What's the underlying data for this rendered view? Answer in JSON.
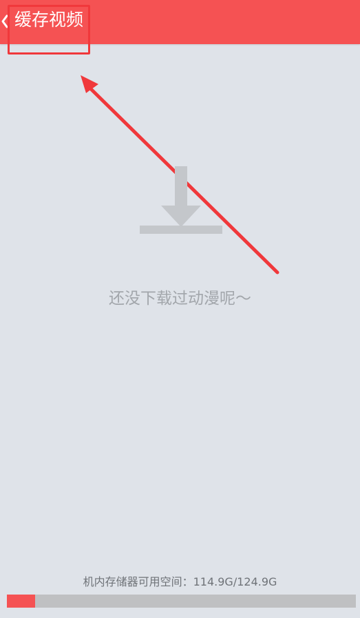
{
  "colors": {
    "header": "#f55253",
    "background": "#dfe3e9",
    "annotation": "#f0383b",
    "icon": "#c4c7cb",
    "muted_text": "#a2a6ab",
    "storage_bar": "#bfc0c2"
  },
  "header": {
    "back_icon": "chevron-left-icon",
    "title": "缓存视频"
  },
  "empty_state": {
    "icon": "download-icon",
    "message": "还没下载过动漫呢～"
  },
  "storage": {
    "label": "机内存储器可用空间：",
    "value": "114.9G/124.9G",
    "used_fraction": 0.08
  },
  "annotation": {
    "shape": "arrow-pointing-to-title"
  }
}
